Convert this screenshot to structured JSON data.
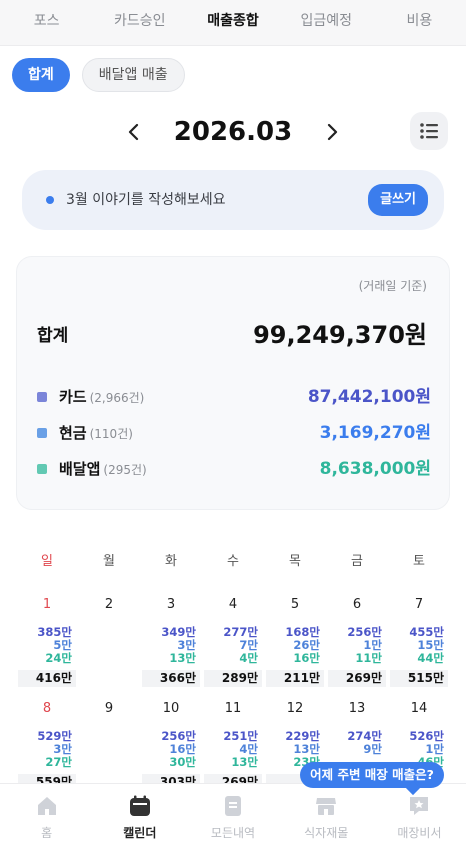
{
  "top_tabs": [
    "포스",
    "카드승인",
    "매출종합",
    "입금예정",
    "비용"
  ],
  "chips": {
    "total": "합계",
    "delivery": "배달앱 매출"
  },
  "month": "2026.03",
  "story": {
    "prompt": "3월 이야기를 작성해보세요",
    "button": "글쓰기"
  },
  "summary": {
    "basis": "(거래일 기준)",
    "total_label": "합계",
    "total_value": "99,249,370원",
    "rows": [
      {
        "label": "카드",
        "count": "(2,966건)",
        "value": "87,442,100원",
        "color": "#7b85d9",
        "value_color": "#4b55c8"
      },
      {
        "label": "현금",
        "count": "(110건)",
        "value": "3,169,270원",
        "color": "#6aa0e6",
        "value_color": "#3b7ded"
      },
      {
        "label": "배달앱",
        "count": "(295건)",
        "value": "8,638,000원",
        "color": "#62c9b3",
        "value_color": "#2fb69b"
      }
    ]
  },
  "weekdays": [
    "일",
    "월",
    "화",
    "수",
    "목",
    "금",
    "토"
  ],
  "weeks": [
    [
      {
        "day": "1",
        "card": "385만",
        "cash": "5만",
        "app": "24만",
        "total": "416만"
      },
      {
        "day": "2",
        "card": "",
        "cash": "",
        "app": "",
        "total": ""
      },
      {
        "day": "3",
        "card": "349만",
        "cash": "3만",
        "app": "13만",
        "total": "366만"
      },
      {
        "day": "4",
        "card": "277만",
        "cash": "7만",
        "app": "4만",
        "total": "289만"
      },
      {
        "day": "5",
        "card": "168만",
        "cash": "26만",
        "app": "16만",
        "total": "211만"
      },
      {
        "day": "6",
        "card": "256만",
        "cash": "1만",
        "app": "11만",
        "total": "269만"
      },
      {
        "day": "7",
        "card": "455만",
        "cash": "15만",
        "app": "44만",
        "total": "515만"
      }
    ],
    [
      {
        "day": "8",
        "card": "529만",
        "cash": "3만",
        "app": "27만",
        "total": "559만"
      },
      {
        "day": "9",
        "card": "",
        "cash": "",
        "app": "",
        "total": ""
      },
      {
        "day": "10",
        "card": "256만",
        "cash": "16만",
        "app": "30만",
        "total": "303만"
      },
      {
        "day": "11",
        "card": "251만",
        "cash": "4만",
        "app": "13만",
        "total": "269만"
      },
      {
        "day": "12",
        "card": "229만",
        "cash": "13만",
        "app": "23만",
        "total": "26"
      },
      {
        "day": "13",
        "card": "274만",
        "cash": "9만",
        "app": "",
        "total": ""
      },
      {
        "day": "14",
        "card": "526만",
        "cash": "1만",
        "app": "46만",
        "total": ""
      }
    ]
  ],
  "tooltip": "어제 주변 매장 매출은?",
  "bottom_nav": [
    "홈",
    "캘린더",
    "모든내역",
    "식자재몰",
    "매장비서"
  ],
  "colors": {
    "accent": "#3b7ded",
    "sunday": "#e0484f"
  }
}
